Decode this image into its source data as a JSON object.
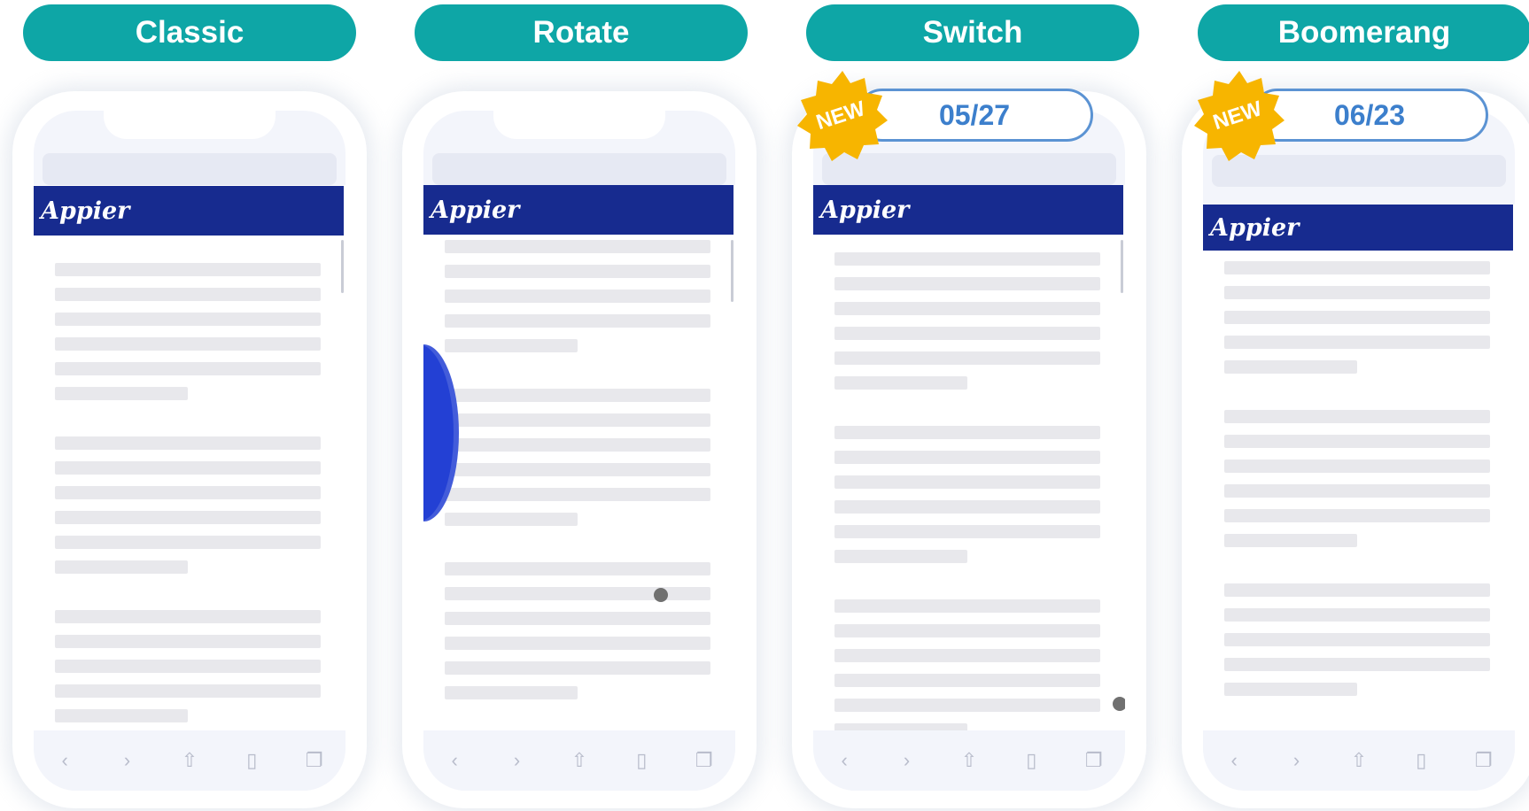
{
  "columns": [
    {
      "label": "Classic"
    },
    {
      "label": "Rotate"
    },
    {
      "label": "Switch",
      "badge": "NEW",
      "date": "05/27"
    },
    {
      "label": "Boomerang",
      "badge": "NEW",
      "date": "06/23"
    }
  ],
  "brand": "Appier",
  "toolbar_icons": [
    "back-icon",
    "forward-icon",
    "share-icon",
    "bookmarks-icon",
    "tabs-icon"
  ],
  "colors": {
    "pill": "#0ea6a6",
    "header": "#172b8f",
    "badge_border": "#5b93d3",
    "burst": "#f7b500",
    "blob": "#2340d4"
  }
}
